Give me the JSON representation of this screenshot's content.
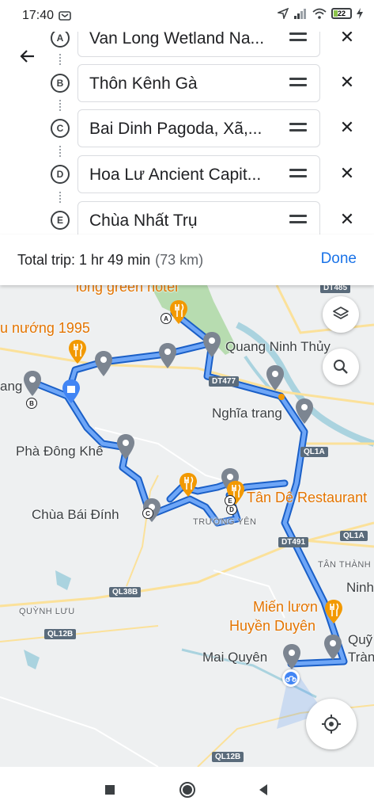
{
  "status_bar": {
    "time": "17:40",
    "battery": "22"
  },
  "route": {
    "stops": [
      {
        "marker": "A",
        "text": "Van Long Wetland Na..."
      },
      {
        "marker": "B",
        "text": "Thôn Kênh Gà"
      },
      {
        "marker": "C",
        "text": "Bai Dinh Pagoda, Xã,..."
      },
      {
        "marker": "D",
        "text": "Hoa Lư Ancient Capit..."
      },
      {
        "marker": "E",
        "text": "Chùa Nhất Trụ"
      }
    ]
  },
  "trip": {
    "summary": "Total trip: 1 hr 49 min",
    "distance": "(73 km)",
    "done_label": "Done"
  },
  "map": {
    "labels": {
      "long_green_hotel": "long green hotel",
      "nuong_1995": "u nướng 1995",
      "quang_ninh_thuy": "Quang Ninh Thủy",
      "nghia_trang": "Nghĩa trang",
      "ang": "ang",
      "pha_dong_khe": "Phà Đông Khê",
      "chua_bai_dinh": "Chùa Bái Đính",
      "truong_yen": "TRƯỜNG YÊN",
      "tan_de_restaurant": "Tân Dê Restaurant",
      "tan_thanh": "TÂN THÀNH",
      "ninh": "Ninh",
      "quynh_luu": "QUỲNH LƯU",
      "mien_luon": "Miến lươn",
      "huyen_duyen": "Huyền Duyên",
      "mai_quyen": "Mai Quyên",
      "quy": "Quỹ",
      "tran": "Tràn"
    },
    "roads": {
      "dt485": "DT485",
      "dt477": "DT477",
      "ql1a_1": "QL1A",
      "ql1a_2": "QL1A",
      "dt491": "DT491",
      "ql38b": "QL38B",
      "ql12b_1": "QL12B",
      "ql12b_2": "QL12B"
    },
    "waypoints": {
      "a": "A",
      "b": "B",
      "c": "C",
      "d": "D",
      "e": "E"
    },
    "colors": {
      "route": "#4285f4",
      "route_outline": "#1a5fc7",
      "water": "#aad3df",
      "park": "#b7dcb0",
      "poi": "#f29900"
    }
  }
}
